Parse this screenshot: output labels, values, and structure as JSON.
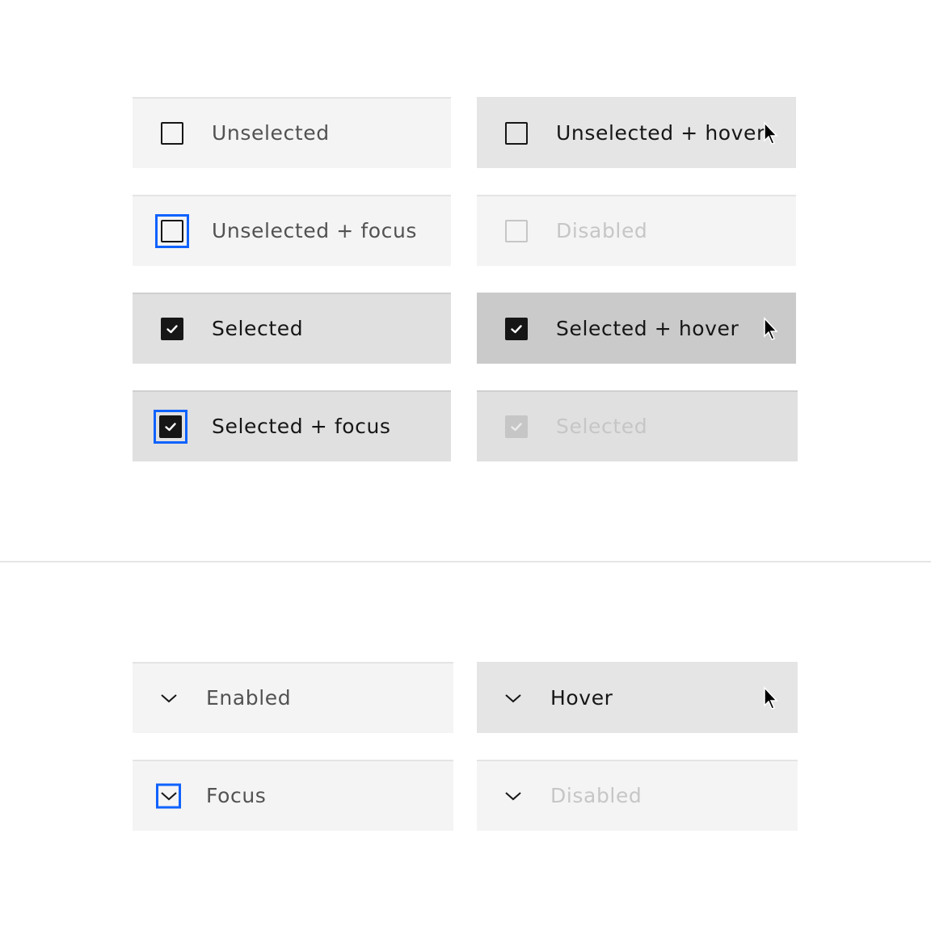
{
  "checkbox_states": {
    "unselected": {
      "label": "Unselected",
      "checked": false,
      "state": "enabled"
    },
    "unselected_hover": {
      "label": "Unselected + hover",
      "checked": false,
      "state": "hover"
    },
    "unselected_focus": {
      "label": "Unselected + focus",
      "checked": false,
      "state": "focus"
    },
    "disabled": {
      "label": "Disabled",
      "checked": false,
      "state": "disabled"
    },
    "selected": {
      "label": "Selected",
      "checked": true,
      "state": "enabled"
    },
    "selected_hover": {
      "label": "Selected + hover",
      "checked": true,
      "state": "hover"
    },
    "selected_focus": {
      "label": "Selected + focus",
      "checked": true,
      "state": "focus"
    },
    "selected_disabled": {
      "label": "Selected",
      "checked": true,
      "state": "disabled"
    }
  },
  "accordion_states": {
    "enabled": {
      "label": "Enabled",
      "icon": "chevron-down-icon",
      "state": "enabled"
    },
    "hover": {
      "label": "Hover",
      "icon": "chevron-down-icon",
      "state": "hover"
    },
    "focus": {
      "label": "Focus",
      "icon": "chevron-down-icon",
      "state": "focus"
    },
    "disabled": {
      "label": "Disabled",
      "icon": "chevron-down-icon",
      "state": "disabled"
    }
  },
  "colors": {
    "focus": "#0f62fe",
    "text_primary": "#161616",
    "text_secondary": "#525252",
    "text_disabled": "#c6c6c6",
    "field": "#f4f4f4",
    "field_hover": "#e5e5e5",
    "selected": "#e0e0e0",
    "selected_hover": "#cacaca"
  }
}
